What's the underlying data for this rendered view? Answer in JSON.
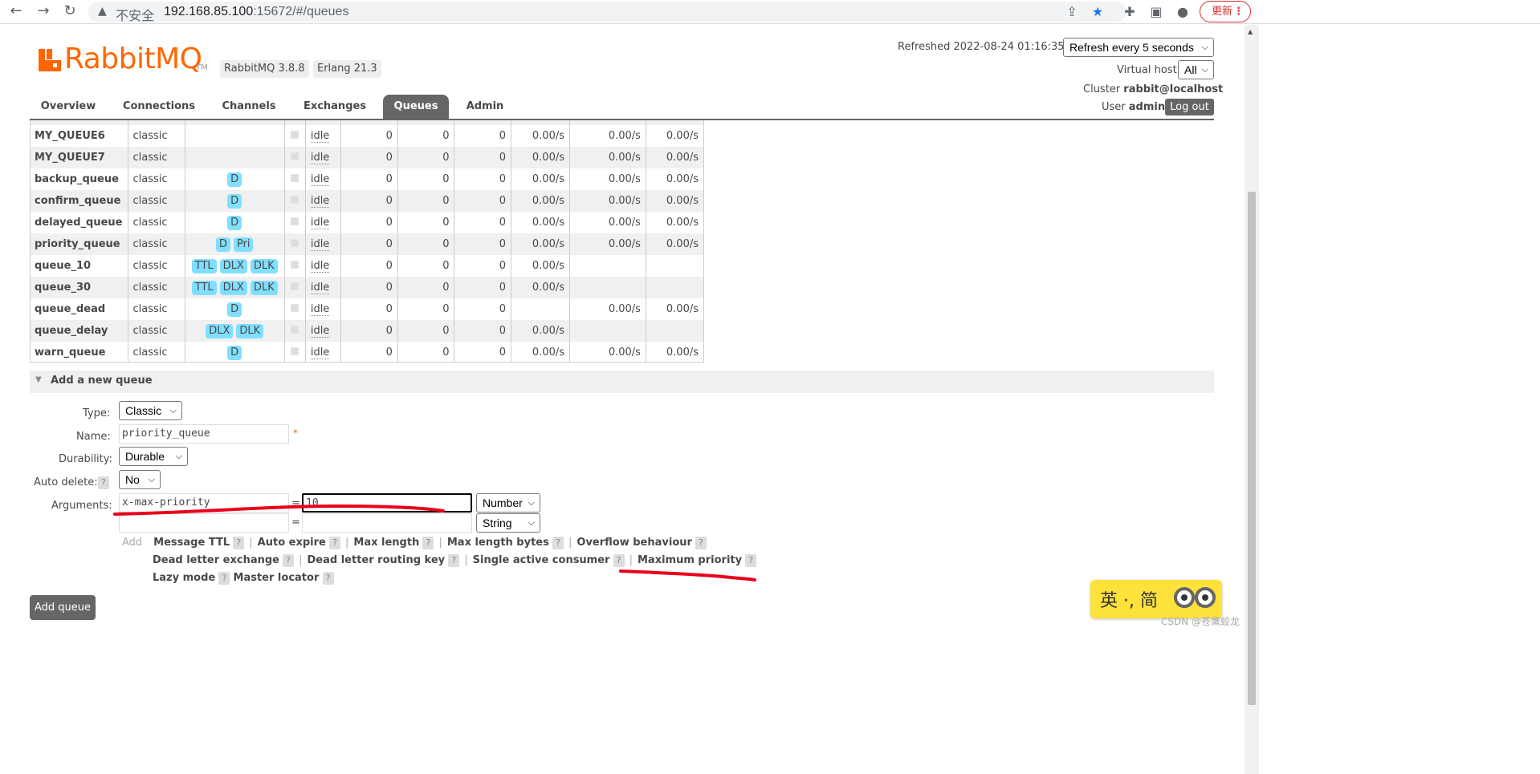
{
  "browser": {
    "insecure_label": "不安全",
    "url_host": "192.168.85.100",
    "url_path": ":15672/#/queues",
    "update_label": "更新"
  },
  "header": {
    "logo_text": "RabbitMQ",
    "logo_tm": "TM",
    "rabbit_version": "RabbitMQ 3.8.8",
    "erlang_version": "Erlang 21.3",
    "refreshed": "Refreshed 2022-08-24 01:16:35",
    "refresh_select": "Refresh every 5 seconds",
    "vhost_label": "Virtual host",
    "vhost_select": "All",
    "cluster_label": "Cluster",
    "cluster_value": "rabbit@localhost",
    "user_label": "User",
    "user_value": "admin",
    "logout_label": "Log out"
  },
  "tabs": [
    {
      "label": "Overview"
    },
    {
      "label": "Connections"
    },
    {
      "label": "Channels"
    },
    {
      "label": "Exchanges"
    },
    {
      "label": "Queues",
      "active": true
    },
    {
      "label": "Admin"
    }
  ],
  "queues": [
    {
      "name": "MY_QUEUE6",
      "type": "classic",
      "features": [],
      "state": "idle",
      "ready": "0",
      "unacked": "0",
      "total": "0",
      "incoming": "0.00/s",
      "deliver": "0.00/s",
      "ack": "0.00/s"
    },
    {
      "name": "MY_QUEUE7",
      "type": "classic",
      "features": [],
      "state": "idle",
      "ready": "0",
      "unacked": "0",
      "total": "0",
      "incoming": "0.00/s",
      "deliver": "0.00/s",
      "ack": "0.00/s"
    },
    {
      "name": "backup_queue",
      "type": "classic",
      "features": [
        "D"
      ],
      "state": "idle",
      "ready": "0",
      "unacked": "0",
      "total": "0",
      "incoming": "0.00/s",
      "deliver": "0.00/s",
      "ack": "0.00/s"
    },
    {
      "name": "confirm_queue",
      "type": "classic",
      "features": [
        "D"
      ],
      "state": "idle",
      "ready": "0",
      "unacked": "0",
      "total": "0",
      "incoming": "0.00/s",
      "deliver": "0.00/s",
      "ack": "0.00/s"
    },
    {
      "name": "delayed_queue",
      "type": "classic",
      "features": [
        "D"
      ],
      "state": "idle",
      "ready": "0",
      "unacked": "0",
      "total": "0",
      "incoming": "0.00/s",
      "deliver": "0.00/s",
      "ack": "0.00/s"
    },
    {
      "name": "priority_queue",
      "type": "classic",
      "features": [
        "D",
        "Pri"
      ],
      "state": "idle",
      "ready": "0",
      "unacked": "0",
      "total": "0",
      "incoming": "0.00/s",
      "deliver": "0.00/s",
      "ack": "0.00/s"
    },
    {
      "name": "queue_10",
      "type": "classic",
      "features": [
        "TTL",
        "DLX",
        "DLK"
      ],
      "state": "idle",
      "ready": "0",
      "unacked": "0",
      "total": "0",
      "incoming": "0.00/s",
      "deliver": "",
      "ack": ""
    },
    {
      "name": "queue_30",
      "type": "classic",
      "features": [
        "TTL",
        "DLX",
        "DLK"
      ],
      "state": "idle",
      "ready": "0",
      "unacked": "0",
      "total": "0",
      "incoming": "0.00/s",
      "deliver": "",
      "ack": ""
    },
    {
      "name": "queue_dead",
      "type": "classic",
      "features": [
        "D"
      ],
      "state": "idle",
      "ready": "0",
      "unacked": "0",
      "total": "0",
      "incoming": "",
      "deliver": "0.00/s",
      "ack": "0.00/s"
    },
    {
      "name": "queue_delay",
      "type": "classic",
      "features": [
        "DLX",
        "DLK"
      ],
      "state": "idle",
      "ready": "0",
      "unacked": "0",
      "total": "0",
      "incoming": "0.00/s",
      "deliver": "",
      "ack": ""
    },
    {
      "name": "warn_queue",
      "type": "classic",
      "features": [
        "D"
      ],
      "state": "idle",
      "ready": "0",
      "unacked": "0",
      "total": "0",
      "incoming": "0.00/s",
      "deliver": "0.00/s",
      "ack": "0.00/s"
    }
  ],
  "add_queue": {
    "section_title": "Add a new queue",
    "type_label": "Type:",
    "type_value": "Classic",
    "name_label": "Name:",
    "name_value": "priority_queue",
    "required_mark": "*",
    "durability_label": "Durability:",
    "durability_value": "Durable",
    "auto_delete_label": "Auto delete:",
    "auto_delete_value": "No",
    "arguments_label": "Arguments:",
    "arg1_key": "x-max-priority",
    "arg1_value": "10",
    "arg1_type": "Number",
    "arg2_key": "",
    "arg2_value": "",
    "arg2_type": "String",
    "equals": "=",
    "add_label": "Add",
    "help_mark": "?",
    "arg_shortcuts": [
      "Message TTL",
      "Auto expire",
      "Max length",
      "Max length bytes",
      "Overflow behaviour",
      "Dead letter exchange",
      "Dead letter routing key",
      "Single active consumer",
      "Maximum priority",
      "Lazy mode",
      "Master locator"
    ],
    "submit_label": "Add queue"
  },
  "ime": {
    "text": "英 ·, 简"
  },
  "watermark": "CSDN @苍鹰蛟龙",
  "annotation_color": "#e8001c"
}
